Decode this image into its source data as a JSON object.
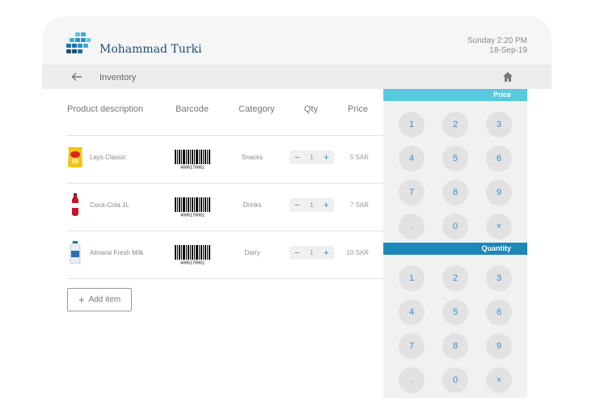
{
  "header": {
    "user_name": "Mohammad Turki",
    "day_time": "Sunday 2:20 PM",
    "date": "18-Sep-19"
  },
  "nav": {
    "title": "Inventory",
    "back_icon": "arrow-left-icon",
    "home_icon": "home-icon"
  },
  "table": {
    "columns": [
      "Product description",
      "Barcode",
      "Category",
      "Qty",
      "Price"
    ],
    "rows": [
      {
        "name": "Lays Classic",
        "category": "Snacks",
        "qty": "1",
        "price": "5 SAR",
        "icon": "chips-bag-icon"
      },
      {
        "name": "Coca-Cola 1L",
        "category": "Drinks",
        "qty": "1",
        "price": "7 SAR",
        "icon": "cola-bottle-icon"
      },
      {
        "name": "Almarai Fresh Milk",
        "category": "Dairy",
        "qty": "1",
        "price": "10 SAR",
        "icon": "milk-bottle-icon"
      }
    ],
    "barcode_number": "4006170002"
  },
  "add_item": {
    "label": "Add item"
  },
  "price_pad": {
    "title": "Price",
    "keys": [
      "1",
      "2",
      "3",
      "4",
      "5",
      "6",
      "7",
      "8",
      "9",
      ".",
      "0",
      "×"
    ],
    "color": "#5bc8dc"
  },
  "quantity_pad": {
    "title": "Quantity",
    "keys": [
      "1",
      "2",
      "3",
      "4",
      "5",
      "6",
      "7",
      "8",
      "9",
      ".",
      "0",
      "×"
    ],
    "color": "#1f86b9"
  },
  "colors": {
    "accent": "#3a8ec9",
    "brand": "#1f4e79"
  }
}
